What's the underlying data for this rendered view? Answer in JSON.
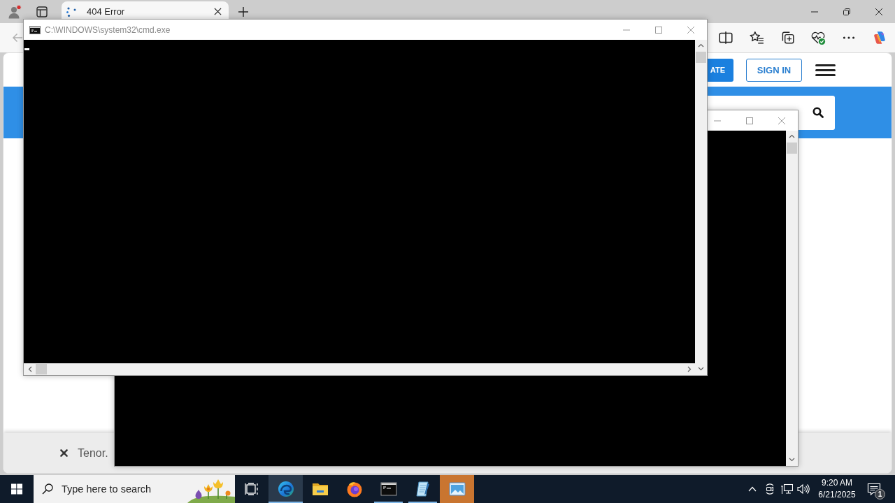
{
  "browser": {
    "tabs": [
      {
        "title": "404 Error",
        "selected": true
      }
    ],
    "header_buttons": [
      {
        "kind": "primary",
        "label": "ATE"
      },
      {
        "kind": "outline",
        "label": "SIGN IN"
      }
    ],
    "banner": {
      "text": "Tenor."
    }
  },
  "console": {
    "title": "C:\\WINDOWS\\system32\\cmd.exe"
  },
  "taskbar": {
    "search": {
      "placeholder": "Type here to search"
    },
    "apps": [
      {
        "kind": "edge",
        "running": true,
        "selected": true,
        "flashing": false
      },
      {
        "kind": "explorer",
        "running": false,
        "selected": false,
        "flashing": false
      },
      {
        "kind": "firefox",
        "running": false,
        "selected": false,
        "flashing": false
      },
      {
        "kind": "terminal",
        "running": true,
        "selected": false,
        "flashing": false
      },
      {
        "kind": "notepad",
        "running": true,
        "selected": false,
        "flashing": false
      },
      {
        "kind": "viewer",
        "running": false,
        "selected": false,
        "flashing": true
      }
    ],
    "clock": {
      "time": "9:20 AM",
      "date": "6/21/2025"
    },
    "notifications": {
      "count": "1"
    }
  }
}
